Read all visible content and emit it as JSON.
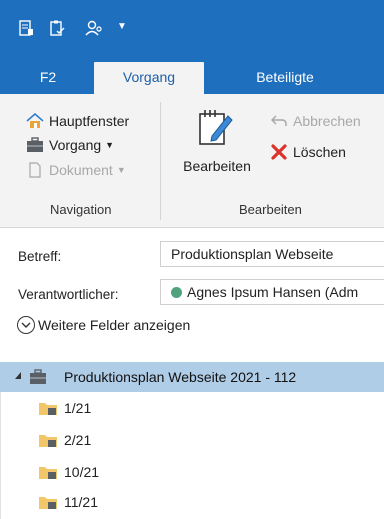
{
  "colors": {
    "accent": "#1f6fbf",
    "ribbon_bg": "#f3f3f3",
    "selected_row": "#b0cde8",
    "status_green": "#4fa27d",
    "delete_red": "#d9342b",
    "folder_yellow": "#f2c76a"
  },
  "quick_access": {
    "icons": [
      "note-icon",
      "clipboard-check-icon",
      "person-key-icon"
    ],
    "dropdown": "customize-dropdown-icon"
  },
  "tabs": [
    {
      "label": "F2"
    },
    {
      "label": "Vorgang",
      "active": true
    },
    {
      "label": "Beteiligte"
    }
  ],
  "ribbon": {
    "navigation": {
      "group_label": "Navigation",
      "hauptfenster": "Hauptfenster",
      "vorgang": "Vorgang",
      "dokument": "Dokument"
    },
    "bearbeiten": {
      "group_label": "Bearbeiten",
      "bearbeiten": "Bearbeiten",
      "abbrechen": "Abbrechen",
      "loeschen": "Löschen"
    }
  },
  "form": {
    "betreff_label": "Betreff:",
    "betreff_value": "Produktionsplan Webseite",
    "verantwortlicher_label": "Verantwortlicher:",
    "verantwortlicher_value": "Agnes Ipsum Hansen (Adm",
    "more_fields": "Weitere Felder anzeigen"
  },
  "tree": {
    "root": "Produktionsplan Webseite 2021 - 112",
    "items": [
      "1/21",
      "2/21",
      "10/21",
      "11/21"
    ]
  }
}
